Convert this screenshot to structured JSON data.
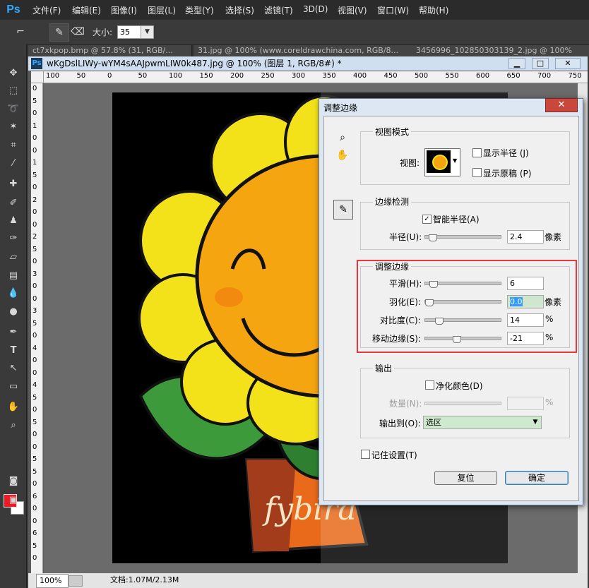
{
  "app": {
    "logo": "Ps"
  },
  "menu": [
    "文件(F)",
    "编辑(E)",
    "图像(I)",
    "图层(L)",
    "类型(Y)",
    "选择(S)",
    "滤镜(T)",
    "3D(D)",
    "视图(V)",
    "窗口(W)",
    "帮助(H)"
  ],
  "options": {
    "size_label": "大小:",
    "size_value": "35"
  },
  "tabs": [
    "ct7xkpop.bmp @ 57.8% (31, RGB/...",
    "31.jpg @ 100% (www.coreldrawchina.com, RGB/8...",
    "3456996_102850303139_2.jpg @ 100%"
  ],
  "document": {
    "title": "wKgDslLIWy-wYM4sAAJpwmLIW0k487.jpg @ 100% (图层 1, RGB/8#) *",
    "ruler_top": [
      "100",
      "50",
      "0",
      "50",
      "100",
      "150",
      "200",
      "250",
      "300",
      "350",
      "400",
      "450",
      "500",
      "550",
      "600",
      "650",
      "700",
      "750"
    ],
    "ruler_left": [
      "0",
      "5",
      "0",
      "1",
      "0",
      "0",
      "1",
      "5",
      "0",
      "2",
      "0",
      "0",
      "2",
      "5",
      "0",
      "3",
      "0",
      "0",
      "3",
      "5",
      "0",
      "4",
      "0",
      "0",
      "4",
      "5",
      "0",
      "5",
      "0",
      "0",
      "5",
      "5",
      "0",
      "6",
      "0",
      "0",
      "6",
      "5",
      "0"
    ],
    "zoom": "100%",
    "doc_size": "文档:1.07M/2.13M",
    "art_text": "fybira"
  },
  "dialog": {
    "title": "调整边缘",
    "close": "✕",
    "view_mode": {
      "group": "视图模式",
      "view_label": "视图:",
      "show_radius": "显示半径 (J)",
      "show_original": "显示原稿 (P)"
    },
    "edge_detection": {
      "group": "边缘检测",
      "smart_radius": "智能半径(A)",
      "radius_label": "半径(U):",
      "radius_value": "2.4",
      "radius_unit": "像素",
      "radius_level": 0.05
    },
    "adjust_edge": {
      "group": "调整边缘",
      "smooth_label": "平滑(H):",
      "smooth_value": "6",
      "smooth_level": 0.06,
      "feather_label": "羽化(E):",
      "feather_value": "0.0",
      "feather_unit": "像素",
      "feather_level": 0.0,
      "contrast_label": "对比度(C):",
      "contrast_value": "14",
      "contrast_unit": "%",
      "contrast_level": 0.14,
      "shift_label": "移动边缘(S):",
      "shift_value": "-21",
      "shift_unit": "%",
      "shift_level": 0.395
    },
    "output": {
      "group": "输出",
      "decontaminate": "净化颜色(D)",
      "amount_label": "数量(N):",
      "amount_unit": "%",
      "output_to_label": "输出到(O):",
      "output_to_value": "选区"
    },
    "remember": "记住设置(T)",
    "reset_button": "复位",
    "ok_button": "确定"
  },
  "colors": {
    "foreground": "#ed1c24",
    "background": "#ffffff",
    "highlight": "#e8383d"
  }
}
